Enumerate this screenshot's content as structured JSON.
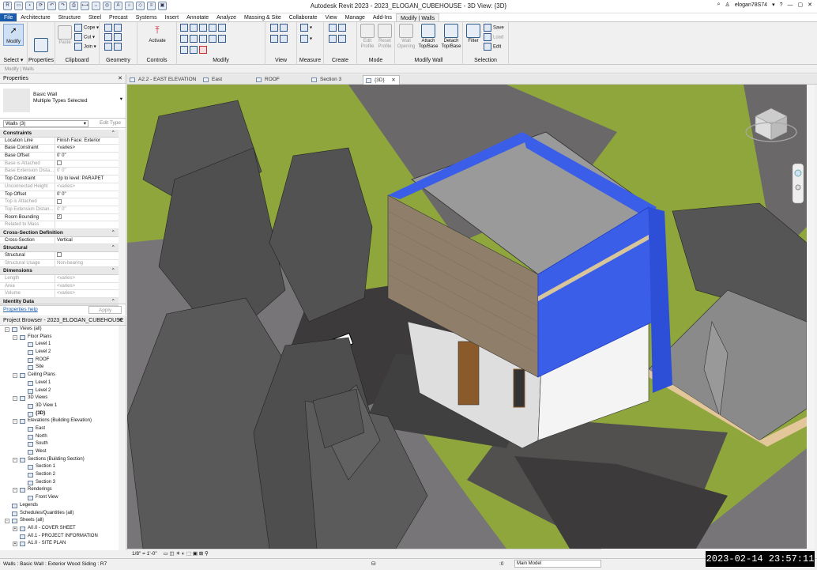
{
  "window": {
    "title": "Autodesk Revit 2023 - 2023_ELOGAN_CUBEHOUSE - 3D View: {3D}",
    "user": "elogan78S74"
  },
  "menu": {
    "tabs": [
      "File",
      "Architecture",
      "Structure",
      "Steel",
      "Precast",
      "Systems",
      "Insert",
      "Annotate",
      "Analyze",
      "Massing & Site",
      "Collaborate",
      "View",
      "Manage",
      "Add-Ins",
      "Modify | Walls"
    ]
  },
  "ribbon": {
    "select": {
      "modify": "Modify",
      "select_label": "Select ▾",
      "group": "Select"
    },
    "properties": {
      "label": "Properties"
    },
    "clipboard": {
      "paste": "Paste",
      "cope": "Cope",
      "cut": "Cut",
      "join": "Join",
      "group": "Clipboard"
    },
    "geometry": {
      "group": "Geometry"
    },
    "controls": {
      "activate": "Activate",
      "group": "Controls"
    },
    "modify": {
      "group": "Modify"
    },
    "view": {
      "group": "View"
    },
    "measure": {
      "group": "Measure"
    },
    "create": {
      "group": "Create"
    },
    "mode": {
      "edit_profile": "Edit Profile",
      "reset_profile": "Reset Profile",
      "group": "Mode"
    },
    "modify_wall": {
      "wall_opening": "Wall Opening",
      "attach": "Attach Top/Base",
      "detach": "Detach Top/Base",
      "group": "Modify Wall"
    },
    "selection": {
      "filter": "Filter",
      "save": "Save",
      "load": "Load",
      "edit": "Edit",
      "group": "Selection"
    }
  },
  "context_bar": "Modify | Walls",
  "properties": {
    "title": "Properties",
    "type_name": "Basic Wall",
    "type_sub": "Multiple Types Selected",
    "instance": "Walls (3)",
    "edit_type": "Edit Type",
    "sections": [
      {
        "name": "Constraints",
        "rows": [
          {
            "k": "Location Line",
            "v": "Finish Face: Exterior",
            "gray": false
          },
          {
            "k": "Base Constraint",
            "v": "<varies>",
            "gray": false
          },
          {
            "k": "Base Offset",
            "v": "0'  0\"",
            "gray": false
          },
          {
            "k": "Base is Attached",
            "v": "",
            "gray": true,
            "cb": true
          },
          {
            "k": "Base Extension Dista...",
            "v": "0'  0\"",
            "gray": true
          },
          {
            "k": "Top Constraint",
            "v": "Up to level: PARAPET",
            "gray": false
          },
          {
            "k": "Unconnected Height",
            "v": "<varies>",
            "gray": true
          },
          {
            "k": "Top Offset",
            "v": "0'  0\"",
            "gray": false
          },
          {
            "k": "Top is Attached",
            "v": "",
            "gray": true,
            "cb": true
          },
          {
            "k": "Top Extension Distan...",
            "v": "0'  0\"",
            "gray": true
          },
          {
            "k": "Room Bounding",
            "v": "✓",
            "gray": false,
            "cb": true
          },
          {
            "k": "Related to Mass",
            "v": "",
            "gray": true
          }
        ]
      },
      {
        "name": "Cross-Section Definition",
        "rows": [
          {
            "k": "Cross-Section",
            "v": "Vertical",
            "gray": false
          }
        ]
      },
      {
        "name": "Structural",
        "rows": [
          {
            "k": "Structural",
            "v": "",
            "gray": false,
            "cb": true
          },
          {
            "k": "Structural Usage",
            "v": "Non-bearing",
            "gray": true
          }
        ]
      },
      {
        "name": "Dimensions",
        "rows": [
          {
            "k": "Length",
            "v": "<varies>",
            "gray": true
          },
          {
            "k": "Area",
            "v": "<varies>",
            "gray": true
          },
          {
            "k": "Volume",
            "v": "<varies>",
            "gray": true
          }
        ]
      },
      {
        "name": "Identity Data",
        "rows": []
      }
    ],
    "help": "Properties help",
    "apply": "Apply"
  },
  "browser": {
    "title": "Project Browser - 2023_ELOGAN_CUBEHOUSE",
    "nodes": [
      {
        "label": "Views (all)",
        "level": 0,
        "exp": "-"
      },
      {
        "label": "Floor Plans",
        "level": 1,
        "exp": "-"
      },
      {
        "label": "Level 1",
        "level": 2
      },
      {
        "label": "Level 2",
        "level": 2
      },
      {
        "label": "ROOF",
        "level": 2
      },
      {
        "label": "Site",
        "level": 2
      },
      {
        "label": "Ceiling Plans",
        "level": 1,
        "exp": "-"
      },
      {
        "label": "Level 1",
        "level": 2
      },
      {
        "label": "Level 2",
        "level": 2
      },
      {
        "label": "3D Views",
        "level": 1,
        "exp": "-"
      },
      {
        "label": "3D View 1",
        "level": 2
      },
      {
        "label": "{3D}",
        "level": 2,
        "bold": true
      },
      {
        "label": "Elevations (Building Elevation)",
        "level": 1,
        "exp": "-"
      },
      {
        "label": "East",
        "level": 2
      },
      {
        "label": "North",
        "level": 2
      },
      {
        "label": "South",
        "level": 2
      },
      {
        "label": "West",
        "level": 2
      },
      {
        "label": "Sections (Building Section)",
        "level": 1,
        "exp": "-"
      },
      {
        "label": "Section 1",
        "level": 2
      },
      {
        "label": "Section 2",
        "level": 2
      },
      {
        "label": "Section 3",
        "level": 2
      },
      {
        "label": "Renderings",
        "level": 1,
        "exp": "-"
      },
      {
        "label": "Front View",
        "level": 2
      },
      {
        "label": "Legends",
        "level": 0,
        "exp": ""
      },
      {
        "label": "Schedules/Quantities (all)",
        "level": 0,
        "exp": ""
      },
      {
        "label": "Sheets (all)",
        "level": 0,
        "exp": "-"
      },
      {
        "label": "A0.0 - COVER SHEET",
        "level": 1,
        "exp": "+"
      },
      {
        "label": "A0.1 - PROJECT INFORMATION",
        "level": 1,
        "exp": ""
      },
      {
        "label": "A1.0 - SITE PLAN",
        "level": 1,
        "exp": "+"
      }
    ]
  },
  "view_tabs": [
    {
      "label": "A2.2 - EAST ELEVATION",
      "active": false
    },
    {
      "label": "East",
      "active": false
    },
    {
      "label": "ROOF",
      "active": false
    },
    {
      "label": "Section 3",
      "active": false
    },
    {
      "label": "{3D}",
      "active": true
    }
  ],
  "view_controls": {
    "scale": "1/8\" = 1'-0\""
  },
  "status": {
    "text": "Walls : Basic Wall : Exterior Wood Siding : R7",
    "model": "Main Model",
    "zero": ":0"
  },
  "clock": "2023-02-14  23:57:11",
  "colors": {
    "selection_blue": "#3a5ee8",
    "accent": "#1a5bab",
    "grass": "#8aa53a"
  },
  "viewport": {
    "tag_number": "3"
  }
}
